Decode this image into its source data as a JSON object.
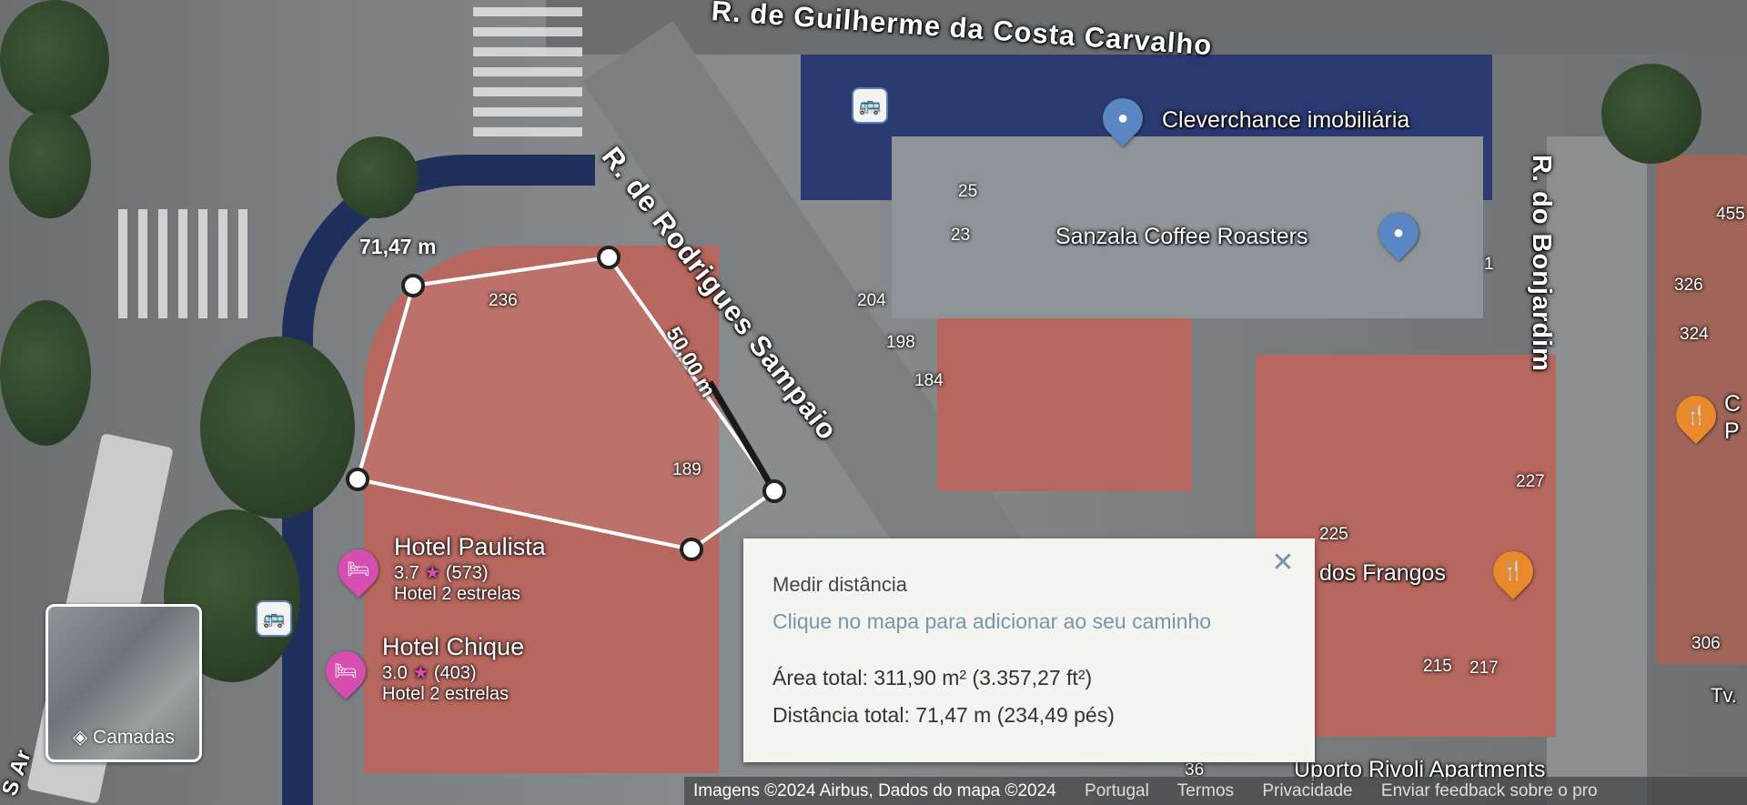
{
  "map": {
    "streets": {
      "guilherme": "R. de Guilherme da Costa Carvalho",
      "rodrigues": "R. de Rodrigues Sampaio",
      "bonjardim": "R. do Bonjardim",
      "left_edge": "S Ar"
    },
    "house_numbers": [
      "25",
      "23",
      "204",
      "198",
      "184",
      "236",
      "189",
      "1",
      "455",
      "326",
      "324",
      "227",
      "225",
      "215",
      "217",
      "306",
      "36"
    ],
    "places": {
      "cleverchance": {
        "name": "Cleverchance imobiliária",
        "icon": "location-pin-icon",
        "color": "#5b86c4"
      },
      "sanzala": {
        "name": "Sanzala Coffee Roasters",
        "icon": "location-pin-icon",
        "color": "#5b86c4"
      },
      "frangos": {
        "name": "dos Frangos",
        "icon": "restaurant-icon",
        "color": "#e8892b"
      },
      "right_restaurant": {
        "name": "C",
        "sub": "P",
        "icon": "restaurant-icon",
        "color": "#e8892b"
      },
      "uporto": {
        "name": "Uporto Rivoli Apartments"
      },
      "right_edge_text": "Tv."
    },
    "hotels": [
      {
        "name": "Hotel Paulista",
        "rating": "3.7",
        "reviews": "(573)",
        "category": "Hotel 2 estrelas",
        "icon": "hotel-bed-icon",
        "color": "#d64fb0"
      },
      {
        "name": "Hotel Chique",
        "rating": "3.0",
        "reviews": "(403)",
        "category": "Hotel 2 estrelas",
        "icon": "hotel-bed-icon",
        "color": "#d64fb0"
      }
    ],
    "measure_labels": {
      "segment_1": "71,47 m",
      "segment_2": "50,00 m"
    },
    "measure_line_color": "#ffffff"
  },
  "measure_panel": {
    "title": "Medir distância",
    "hint": "Clique no mapa para adicionar ao seu caminho",
    "area": "Área total: 311,90 m² (3.357,27 ft²)",
    "distance": "Distância total: 71,47 m (234,49 pés)",
    "close_icon": "close-icon"
  },
  "layers_button": {
    "label": "Camadas",
    "icon": "layers-icon"
  },
  "attribution": {
    "imagery": "Imagens ©2024 Airbus, Dados do mapa ©2024",
    "country": "Portugal",
    "terms": "Termos",
    "privacy": "Privacidade",
    "feedback": "Enviar feedback sobre o pro"
  }
}
